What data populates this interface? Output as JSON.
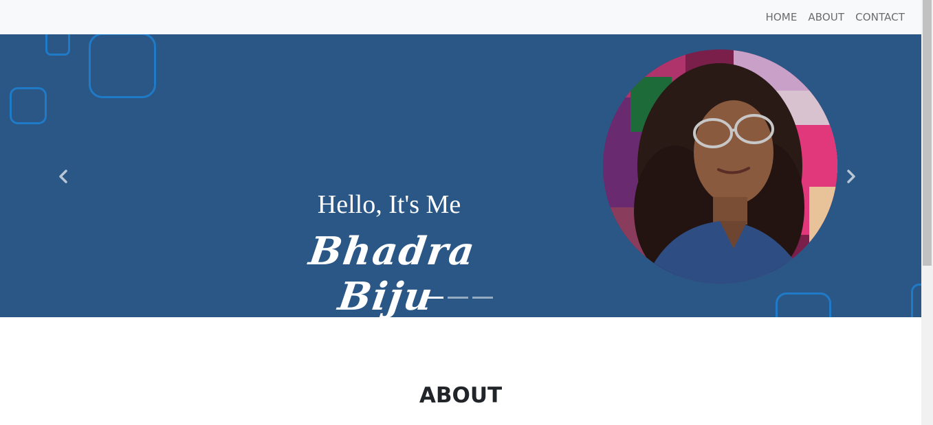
{
  "nav": {
    "items": [
      {
        "label": "HOME"
      },
      {
        "label": "ABOUT"
      },
      {
        "label": "CONTACT"
      }
    ]
  },
  "hero": {
    "greeting": "Hello, It's Me",
    "name": "Bhadra Biju",
    "background_color": "#2a5785",
    "decoration_color": "#1f7ac8",
    "prev_icon": "chevron-left-icon",
    "next_icon": "chevron-right-icon",
    "slide_count": 3,
    "active_slide": 1
  },
  "about": {
    "title": "ABOUT"
  },
  "scroll": {
    "position_fraction": 0
  }
}
